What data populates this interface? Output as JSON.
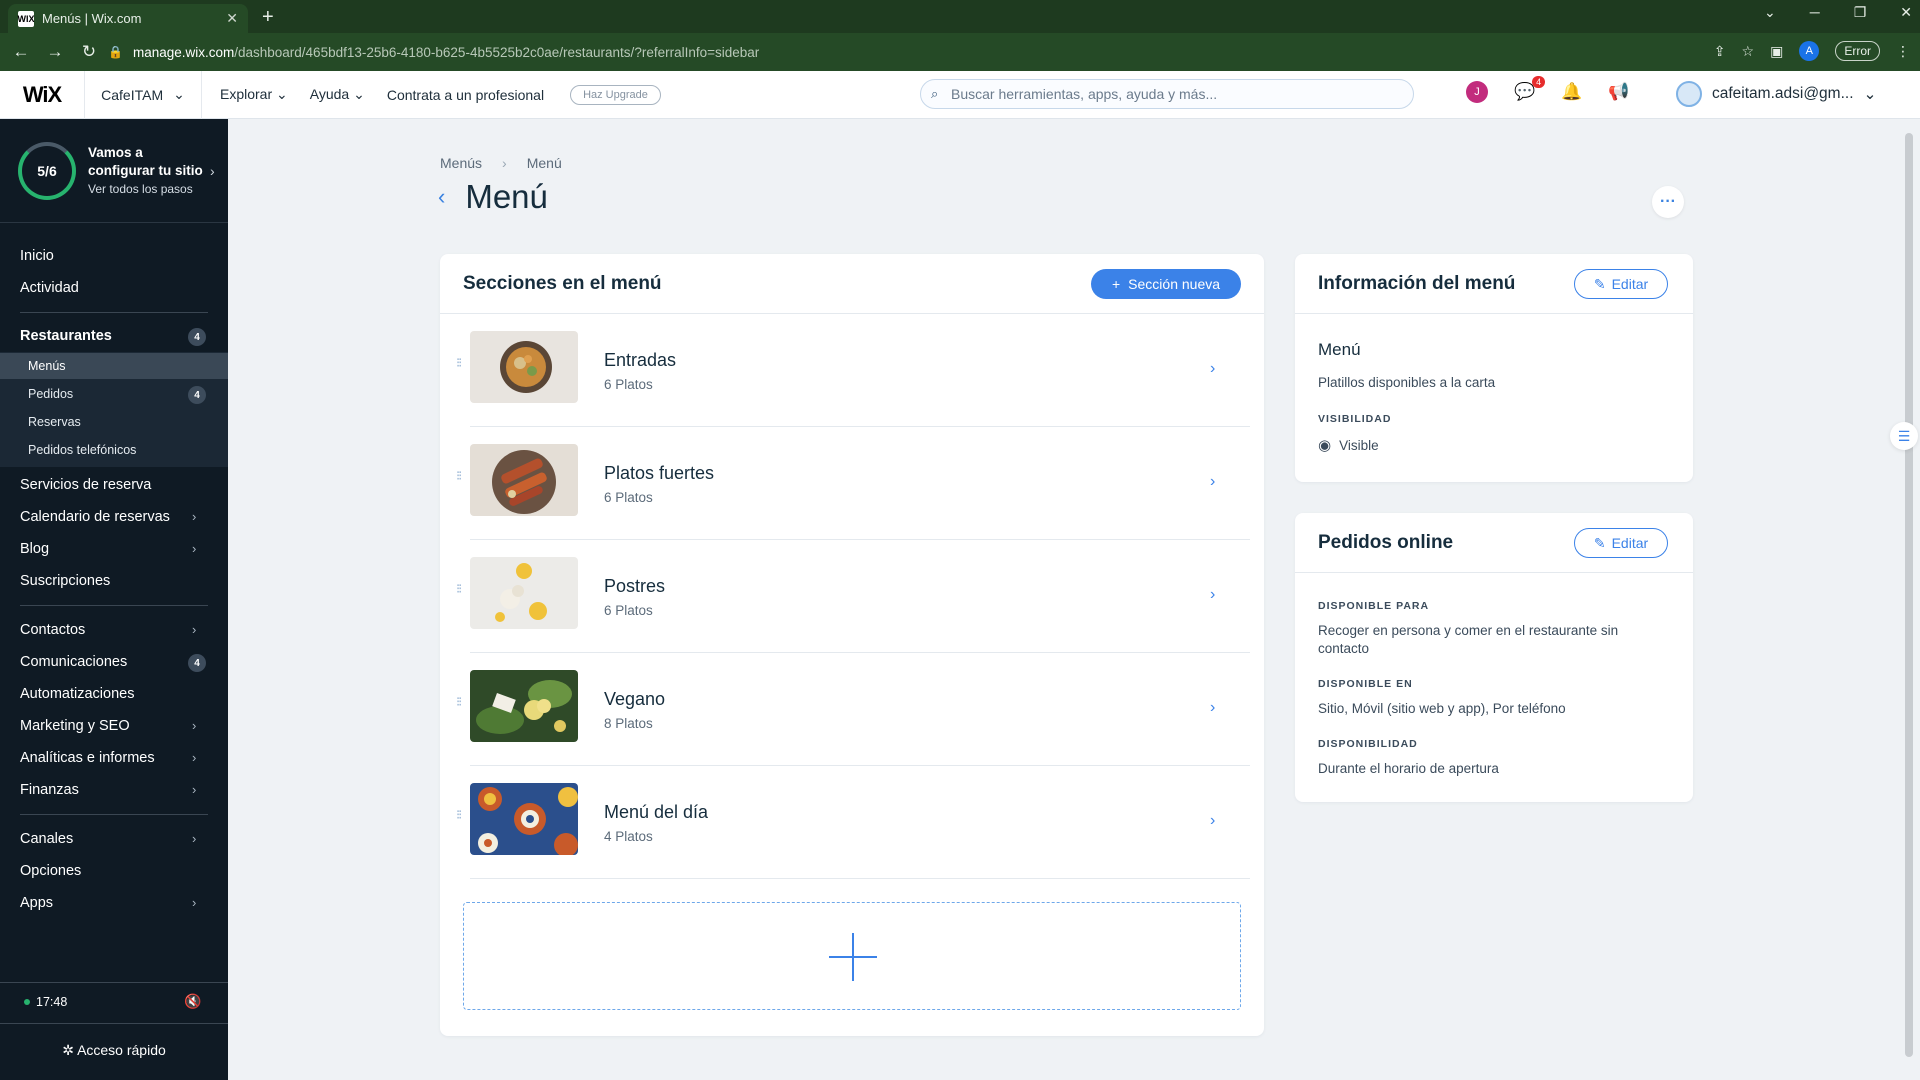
{
  "browser": {
    "tab_title": "Menús | Wix.com",
    "url_host": "manage.wix.com",
    "url_path": "/dashboard/465bdf13-25b6-4180-b625-4b5525b2c0ae/restaurants/?referralInfo=sidebar",
    "error_label": "Error",
    "profile_initial": "A"
  },
  "topbar": {
    "logo": "WiX",
    "site_name": "CafeITAM",
    "nav": [
      "Explorar",
      "Ayuda",
      "Contrata a un profesional"
    ],
    "upgrade_label": "Haz Upgrade",
    "search_placeholder": "Buscar herramientas, apps, ayuda y más...",
    "avatar_initial": "J",
    "notif_count": "4",
    "user_email": "cafeitam.adsi@gm..."
  },
  "sidebar": {
    "setup_progress": "5/6",
    "setup_title": "Vamos a configurar tu sitio",
    "setup_sub": "Ver todos los pasos",
    "inicio": "Inicio",
    "actividad": "Actividad",
    "restaurantes": "Restaurantes",
    "restaurantes_badge": "4",
    "menus": "Menús",
    "pedidos": "Pedidos",
    "pedidos_badge": "4",
    "reservas": "Reservas",
    "pedidos_tel": "Pedidos telefónicos",
    "servicios": "Servicios de reserva",
    "calendario": "Calendario de reservas",
    "blog": "Blog",
    "suscripciones": "Suscripciones",
    "contactos": "Contactos",
    "comunicaciones": "Comunicaciones",
    "comunicaciones_badge": "4",
    "automatizaciones": "Automatizaciones",
    "marketing": "Marketing y SEO",
    "analiticas": "Analíticas e informes",
    "finanzas": "Finanzas",
    "canales": "Canales",
    "opciones": "Opciones",
    "apps": "Apps",
    "time": "17:48",
    "quick_access": "Acceso rápido"
  },
  "page": {
    "breadcrumb_1": "Menús",
    "breadcrumb_2": "Menú",
    "title": "Menú"
  },
  "sections_card": {
    "title": "Secciones en el menú",
    "new_button": "Sección nueva",
    "items": [
      {
        "name": "Entradas",
        "count": "6 Platos"
      },
      {
        "name": "Platos fuertes",
        "count": "6 Platos"
      },
      {
        "name": "Postres",
        "count": "6 Platos"
      },
      {
        "name": "Vegano",
        "count": "8 Platos"
      },
      {
        "name": "Menú del día",
        "count": "4 Platos"
      }
    ]
  },
  "info_card": {
    "title": "Información del menú",
    "edit": "Editar",
    "menu_name": "Menú",
    "description": "Platillos disponibles a la carta",
    "visibility_label": "VISIBILIDAD",
    "visibility_value": "Visible"
  },
  "orders_card": {
    "title": "Pedidos online",
    "edit": "Editar",
    "available_for_label": "DISPONIBLE PARA",
    "available_for_value": "Recoger en persona y comer en el restaurante sin contacto",
    "available_in_label": "DISPONIBLE EN",
    "available_in_value": "Sitio, Móvil (sitio web y app), Por teléfono",
    "availability_label": "DISPONIBILIDAD",
    "availability_value": "Durante el horario de apertura"
  },
  "colors": {
    "accent": "#3b82e8",
    "sidebar_bg": "#0f1a24",
    "browser_bg": "#254a26"
  }
}
